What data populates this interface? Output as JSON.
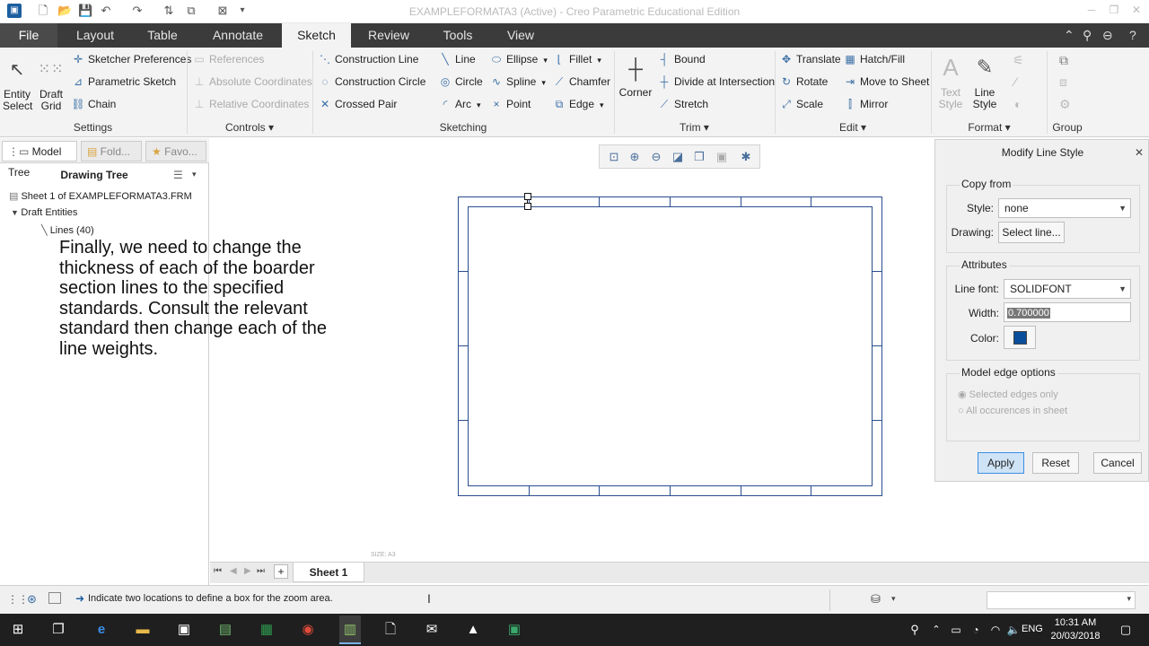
{
  "window": {
    "title": "EXAMPLEFORMATA3 (Active) - Creo Parametric Educational Edition"
  },
  "tabs": [
    "File",
    "Layout",
    "Table",
    "Annotate",
    "Sketch",
    "Review",
    "Tools",
    "View"
  ],
  "ribbon": {
    "settings": {
      "entity_select": "Entity\nSelect",
      "draft_grid": "Draft\nGrid",
      "sketcher_preferences": "Sketcher Preferences",
      "parametric_sketch": "Parametric Sketch",
      "chain": "Chain",
      "group_label": "Settings"
    },
    "controls": {
      "references": "References",
      "absolute_coordinates": "Absolute Coordinates",
      "relative_coordinates": "Relative Coordinates",
      "group_label": "Controls ▾"
    },
    "sketching": {
      "construction_line": "Construction Line",
      "construction_circle": "Construction Circle",
      "crossed_pair": "Crossed Pair",
      "line": "Line",
      "circle": "Circle",
      "arc": "Arc",
      "ellipse": "Ellipse",
      "spline": "Spline",
      "point": "Point",
      "fillet": "Fillet",
      "chamfer": "Chamfer",
      "edge": "Edge",
      "group_label": "Sketching"
    },
    "trim": {
      "corner": "Corner",
      "bound": "Bound",
      "divide_at_intersection": "Divide at Intersection",
      "stretch": "Stretch",
      "group_label": "Trim ▾"
    },
    "edit": {
      "translate": "Translate",
      "rotate": "Rotate",
      "scale": "Scale",
      "hatch_fill": "Hatch/Fill",
      "move_to_sheet": "Move to Sheet",
      "mirror": "Mirror",
      "group_label": "Edit ▾"
    },
    "format": {
      "text_style": "Text\nStyle",
      "line_style": "Line\nStyle",
      "group_label": "Format ▾"
    },
    "group": {
      "group_label": "Group"
    }
  },
  "left_pane": {
    "tabs": [
      "Model Tree",
      "Fold...",
      "Favo..."
    ],
    "title": "Drawing Tree",
    "items": [
      "Sheet 1 of EXAMPLEFORMATA3.FRM",
      "Draft Entities",
      "Lines (40)"
    ]
  },
  "overlay_text": "Finally, we need to change the thickness of each of the boarder section lines to the specified standards. Consult the relevant standard then change each of the line weights.",
  "canvas": {
    "size_label": "SIZE: A3"
  },
  "sheet_bar": {
    "sheet_tab": "Sheet 1"
  },
  "status": {
    "message": "Indicate two locations to define a box for the zoom area."
  },
  "dialog": {
    "title": "Modify Line Style",
    "copy_from": {
      "legend": "Copy from",
      "style_label": "Style:",
      "style_value": "none",
      "drawing_label": "Drawing:",
      "select_line": "Select line..."
    },
    "attributes": {
      "legend": "Attributes",
      "line_font_label": "Line font:",
      "line_font_value": "SOLIDFONT",
      "width_label": "Width:",
      "width_value": "0.700000",
      "color_label": "Color:",
      "color_value": "#0b4f9c"
    },
    "model_edge_options": {
      "legend": "Model edge options",
      "selected_edges_only": "Selected edges only",
      "all_occurences_in_sheet": "All occurences in sheet"
    },
    "buttons": {
      "apply": "Apply",
      "reset": "Reset",
      "cancel": "Cancel"
    }
  },
  "taskbar": {
    "language": "ENG",
    "time": "10:31 AM",
    "date": "20/03/2018"
  },
  "colors": {
    "tab_bar": "#3b3b3b",
    "ribbon": "#f3f3f3",
    "sheet_border": "#2a4d8f",
    "taskbar": "#1f1f1f"
  }
}
